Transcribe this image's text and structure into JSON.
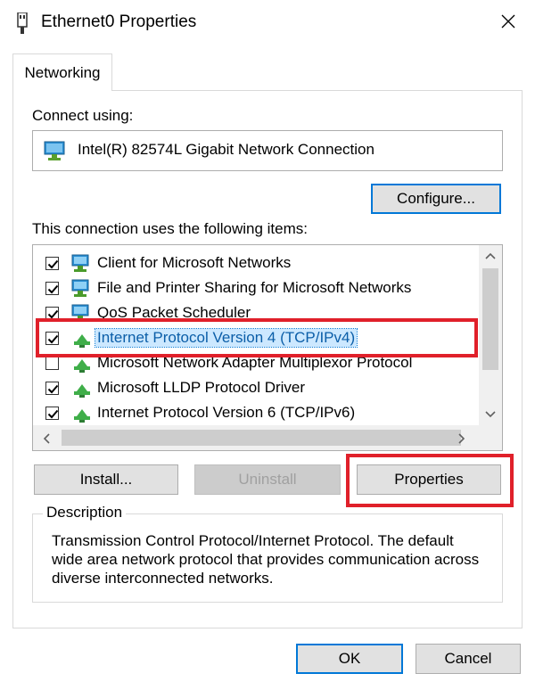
{
  "window": {
    "title": "Ethernet0 Properties",
    "close_glyph": "✕",
    "icon": "network-adapter-icon"
  },
  "tabs": [
    {
      "label": "Networking",
      "active": true
    }
  ],
  "connect_using": {
    "label": "Connect using:",
    "adapter_name": "Intel(R) 82574L Gigabit Network Connection",
    "configure_button": "Configure..."
  },
  "items_section": {
    "label": "This connection uses the following items:",
    "items": [
      {
        "label": "Client for Microsoft Networks",
        "checked": true,
        "icon": "network-client-icon",
        "selected": false
      },
      {
        "label": "File and Printer Sharing for Microsoft Networks",
        "checked": true,
        "icon": "network-service-icon",
        "selected": false
      },
      {
        "label": "QoS Packet Scheduler",
        "checked": true,
        "icon": "network-service-icon",
        "selected": false
      },
      {
        "label": "Internet Protocol Version 4 (TCP/IPv4)",
        "checked": true,
        "icon": "protocol-icon",
        "selected": true
      },
      {
        "label": "Microsoft Network Adapter Multiplexor Protocol",
        "checked": false,
        "icon": "protocol-icon",
        "selected": false
      },
      {
        "label": "Microsoft LLDP Protocol Driver",
        "checked": true,
        "icon": "protocol-icon",
        "selected": false
      },
      {
        "label": "Internet Protocol Version 6 (TCP/IPv6)",
        "checked": true,
        "icon": "protocol-icon",
        "selected": false
      }
    ]
  },
  "action_buttons": {
    "install": "Install...",
    "uninstall": "Uninstall",
    "properties": "Properties"
  },
  "description": {
    "legend": "Description",
    "text": "Transmission Control Protocol/Internet Protocol. The default wide area network protocol that provides communication across diverse interconnected networks."
  },
  "footer": {
    "ok": "OK",
    "cancel": "Cancel"
  },
  "colors": {
    "highlight_red": "#e0202a",
    "focus_blue": "#0078d7",
    "selection_bg": "#cce8ff"
  }
}
